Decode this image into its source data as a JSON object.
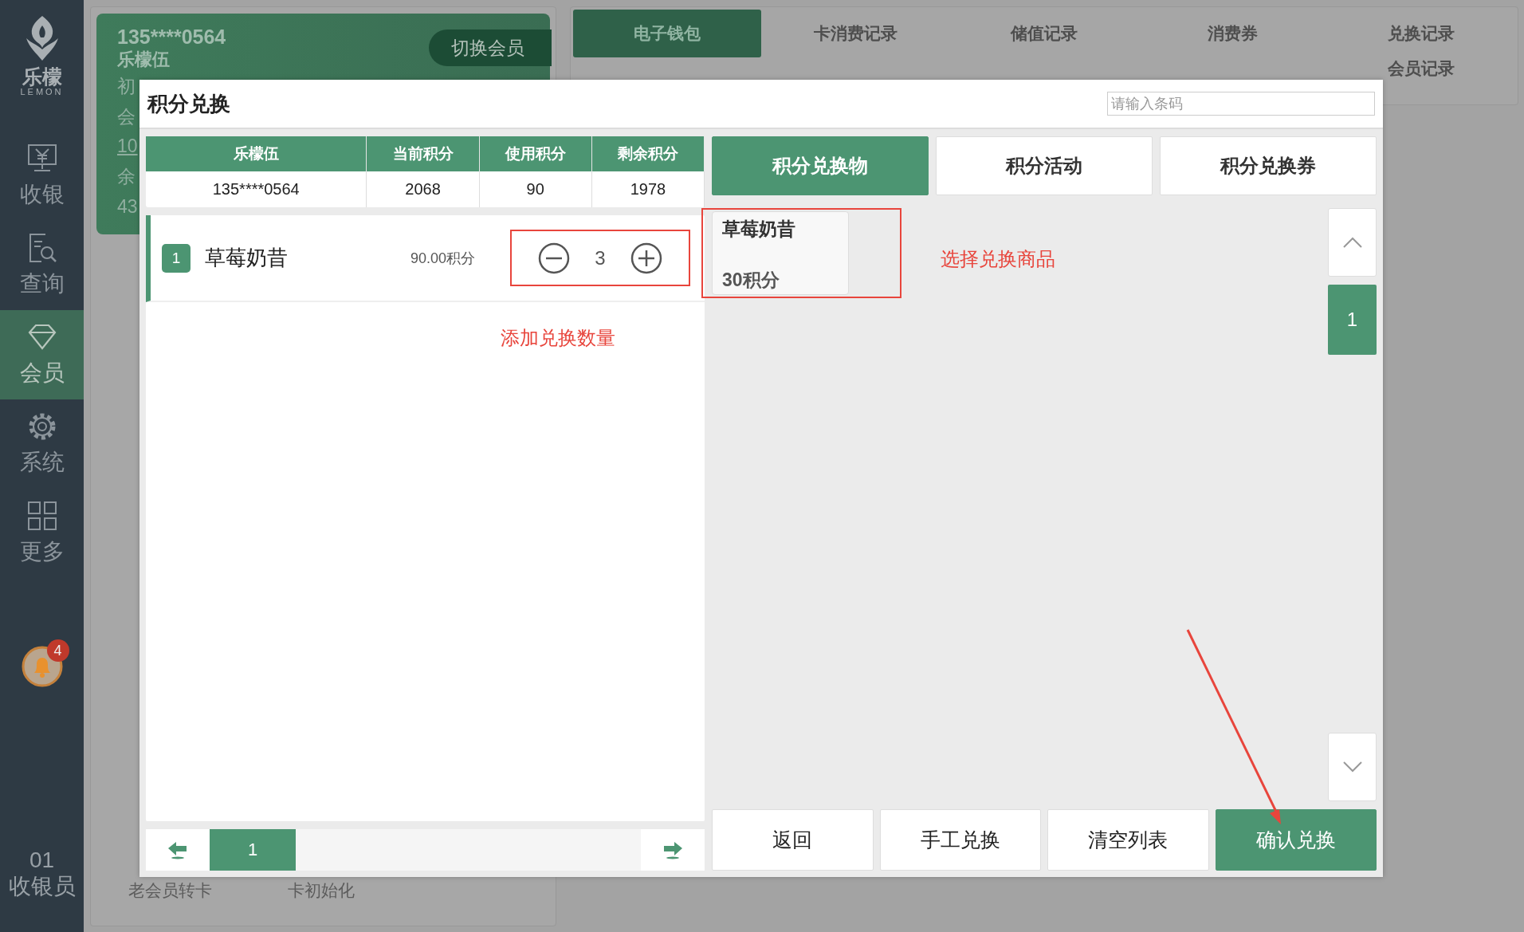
{
  "sidebar": {
    "logo": {
      "name": "乐檬",
      "tagline": "LEMON"
    },
    "items": [
      {
        "label": "收银",
        "selected": false
      },
      {
        "label": "查询",
        "selected": false
      },
      {
        "label": "会员",
        "selected": true
      },
      {
        "label": "系统",
        "selected": false
      },
      {
        "label": "更多",
        "selected": false
      }
    ],
    "notifications": {
      "count": "4"
    },
    "operator": {
      "id": "01",
      "role": "收银员"
    }
  },
  "member_card": {
    "phone": "135****0564",
    "name": "乐檬伍",
    "switch_button": "切换会员",
    "partial_lines": [
      "初",
      "会",
      "10",
      "余",
      "43"
    ]
  },
  "record_tabs": {
    "row_1": [
      {
        "label": "电子钱包",
        "selected": true
      },
      {
        "label": "卡消费记录",
        "selected": false
      },
      {
        "label": "储值记录",
        "selected": false
      },
      {
        "label": "消费券",
        "selected": false
      },
      {
        "label": "兑换记录",
        "selected": false
      }
    ],
    "row_2": [
      {
        "label": "会员记录",
        "selected": false
      }
    ]
  },
  "back_actions": [
    "老会员转卡",
    "卡初始化"
  ],
  "modal": {
    "title": "积分兑换",
    "search": {
      "placeholder": "请输入条码"
    },
    "member_table": {
      "columns": [
        "乐檬伍",
        "当前积分",
        "使用积分",
        "剩余积分"
      ],
      "row": [
        "135****0564",
        "2068",
        "90",
        "1978"
      ]
    },
    "items": [
      {
        "index": "1",
        "name": "草莓奶昔",
        "points": "90.00积分",
        "quantity": "3"
      }
    ],
    "pager": {
      "page": "1"
    },
    "tabs": [
      {
        "label": "积分兑换物",
        "selected": true
      },
      {
        "label": "积分活动",
        "selected": false
      },
      {
        "label": "积分兑换券",
        "selected": false
      }
    ],
    "products": [
      {
        "name": "草莓奶昔",
        "points": "30积分"
      }
    ],
    "product_pager": {
      "page": "1"
    },
    "buttons": [
      {
        "label": "返回",
        "kind": "plain"
      },
      {
        "label": "手工兑换",
        "kind": "plain"
      },
      {
        "label": "清空列表",
        "kind": "plain"
      },
      {
        "label": "确认兑换",
        "kind": "primary"
      }
    ]
  },
  "annotations": [
    {
      "text": "添加兑换数量"
    },
    {
      "text": "选择兑换商品"
    }
  ]
}
